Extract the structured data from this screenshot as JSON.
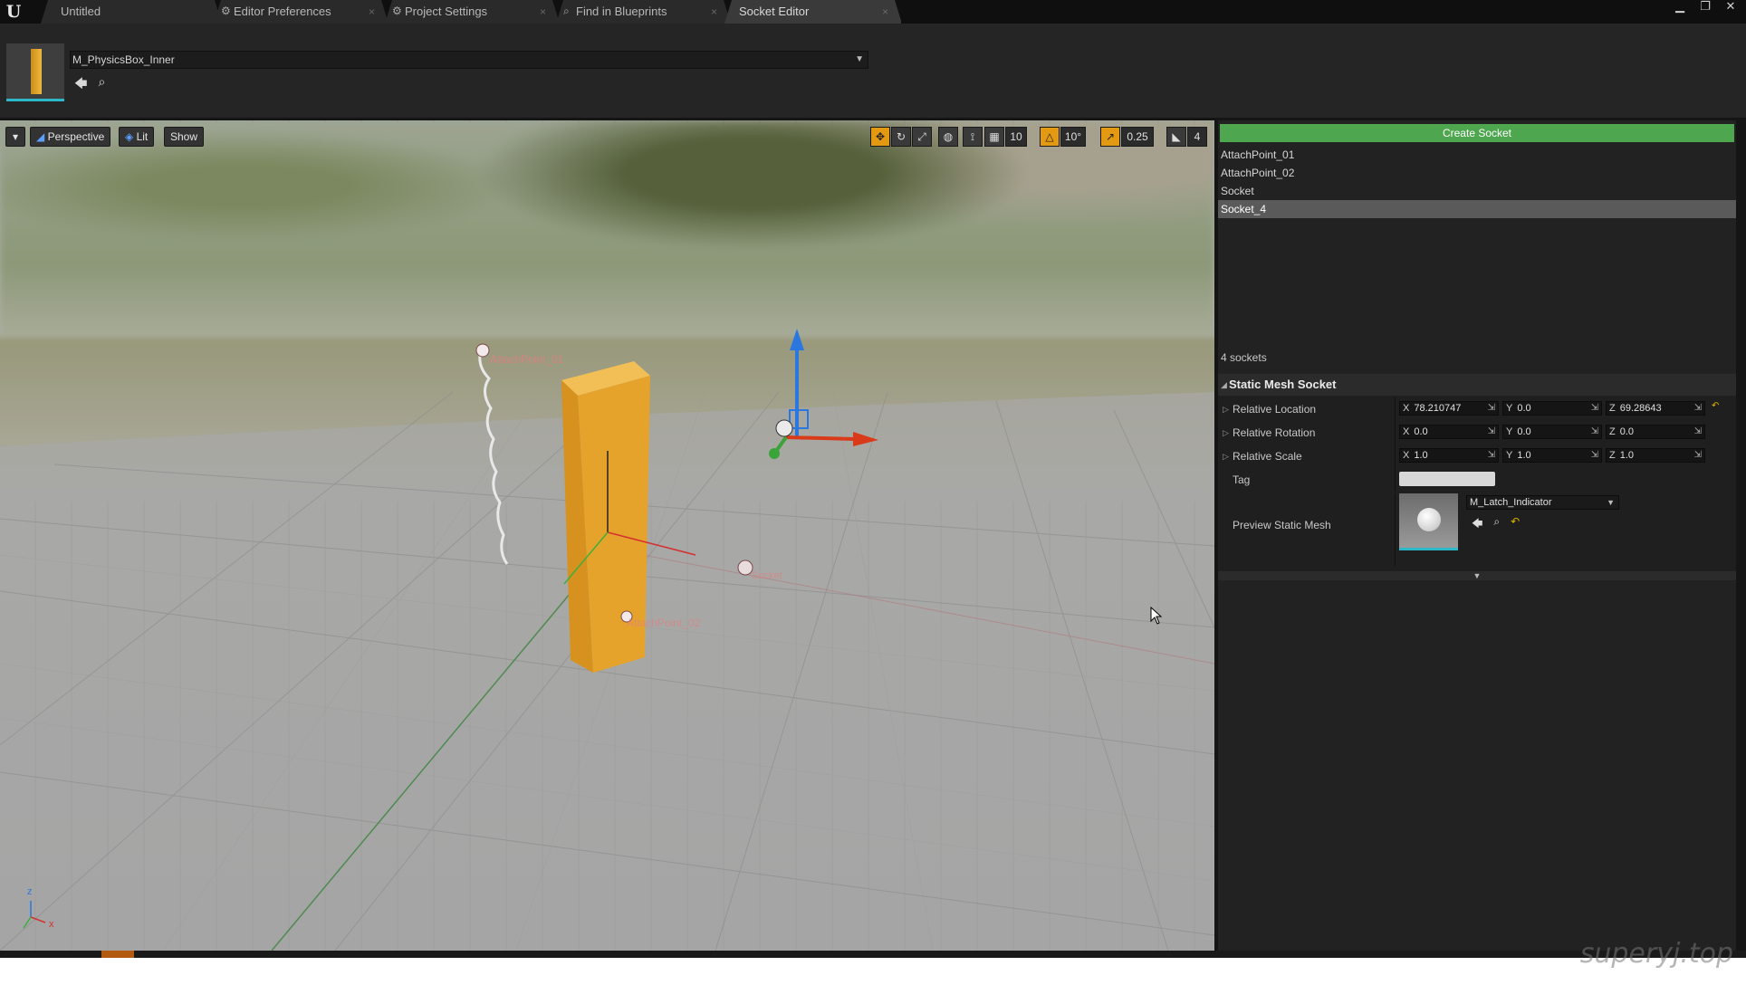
{
  "window": {
    "tabs": [
      {
        "label": "Untitled",
        "icon": "none"
      },
      {
        "label": "Editor Preferences",
        "icon": "preferences-icon"
      },
      {
        "label": "Project Settings",
        "icon": "settings-icon"
      },
      {
        "label": "Find in Blueprints",
        "icon": "search-icon"
      },
      {
        "label": "Socket Editor",
        "icon": "none"
      }
    ],
    "active_tab": "Socket Editor"
  },
  "toolbar": {
    "mesh_name": "M_PhysicsBox_Inner"
  },
  "viewport": {
    "perspective_label": "Perspective",
    "lit_label": "Lit",
    "show_label": "Show",
    "grid_snap": "10",
    "rotation_snap": "10°",
    "scale_snap": "0.25",
    "camera_speed": "4",
    "socket_labels": [
      "AttachPoint_01",
      "AttachPoint_02",
      "Socket"
    ],
    "axis_x": "x",
    "axis_z": "z"
  },
  "socket_panel": {
    "create_label": "Create Socket",
    "sockets": [
      "AttachPoint_01",
      "AttachPoint_02",
      "Socket",
      "Socket_4"
    ],
    "selected": "Socket_4",
    "count_label": "4 sockets",
    "details": {
      "header": "Static Mesh Socket",
      "location_label": "Relative Location",
      "location": {
        "x": "78.210747",
        "y": "0.0",
        "z": "69.28643"
      },
      "rotation_label": "Relative Rotation",
      "rotation": {
        "x": "0.0",
        "y": "0.0",
        "z": "0.0"
      },
      "scale_label": "Relative Scale",
      "scale": {
        "x": "1.0",
        "y": "1.0",
        "z": "1.0"
      },
      "tag_label": "Tag",
      "tag_value": "",
      "preview_label": "Preview Static Mesh",
      "preview_mesh": "M_Latch_Indicator"
    }
  },
  "watermark": "superyj.top",
  "colors": {
    "accent_green": "#4ea64e",
    "selection": "#5a5a5a",
    "orange": "#e39a12",
    "mesh_orange": "#e6a32c"
  }
}
